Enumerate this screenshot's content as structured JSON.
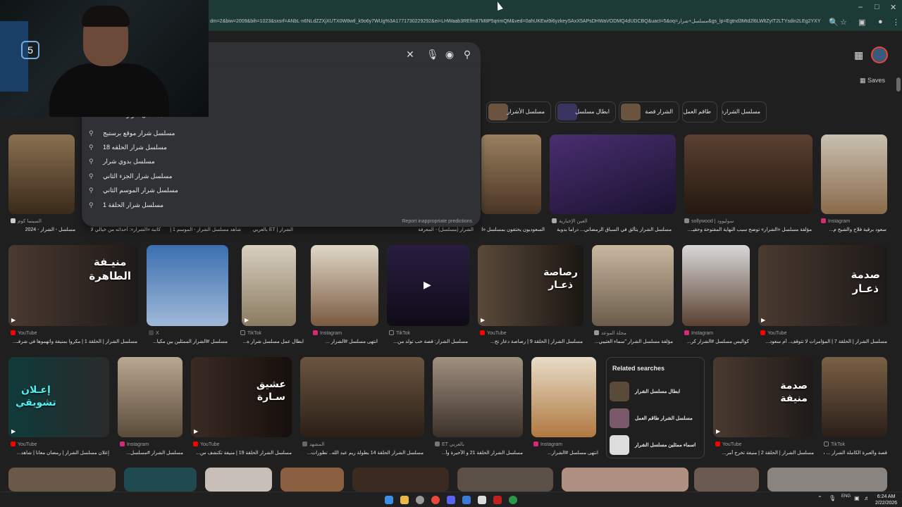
{
  "browser": {
    "url": "dm=2&biw=2009&bih=1023&sxsrf=ANbL-n6NLdZZXjXUTX0W8wtl_k9o6y7WUg%3A1771730229292&ei=LHWaab3REfm87M8P5qrimQM&ved=0ahUKEwi9i6yzkeySAxX5APsDHWaVODMQ4dUDCBQ&uact=5&oq=مسلسل+شرار&gs_lp=Egtnd3Mtd2l6LWltZyIT2LTYsdin2LEg2YXY"
  },
  "search": {
    "suggestions": [
      "مسلسل شرار موقع برستيج",
      "مسلسل شرار الحلقه 18",
      "مسلسل بدوي شرار",
      "مسلسل شرار الجزء الثاني",
      "مسلسل شرار الموسم الثاني",
      "مسلسل شرار الحلقة 1"
    ],
    "partial_suggestion": "مسلسل شرار الحلقة 1",
    "report_label": "Report inappropriate predictions"
  },
  "header": {
    "saves_label": "Saves"
  },
  "chips": [
    "مسلسل الأشرار",
    "ابطال مسلسل",
    "الشرار قصة",
    "طاقم العمل",
    "مسلسل الشرارة"
  ],
  "row1": [
    {
      "source": "Instagram",
      "caption": "سعود برقية فلاح والشيخ م..."
    },
    {
      "source": "sollywood | سوليوود",
      "caption": "مؤلفة مسلسل «الشرار» توضح سبب النهاية المفتوحة وحقيـ..."
    },
    {
      "source": "العين الإخبارية",
      "caption": "مسلسل الشرار يتألق في السباق الرمضاني... دراما بدوية"
    },
    {
      "source": "",
      "caption": "السعوديون يحتفون بمسلسل «الشرا..."
    },
    {
      "source": "",
      "caption": "الشرار (مسلسل) - المعرفة"
    },
    {
      "source": "",
      "caption": "الشرار | ET بالعربي"
    },
    {
      "source": "",
      "caption": "شاهد مسلسل الشرار - الموسم 1 |"
    },
    {
      "source": "",
      "caption": "كاتبة «الشرار»: أحداثه من خيالي لا..."
    },
    {
      "source": "السينما كوم",
      "caption": "مسلسل - الشرار - 2024"
    }
  ],
  "row2": [
    {
      "source": "YouTube",
      "caption": "مسلسل الشرار | الحلقة 1 | مكروا بمنيفة واتهموها في شرفـ...",
      "overlay": "منيـفة\nالطاهرة"
    },
    {
      "source": "X",
      "caption": "مسلسل #الشرار الممثلين بين مكيا...",
      "overlay": ""
    },
    {
      "source": "TikTok",
      "caption": "ابطال عمل مسلسل شرار ه...",
      "overlay": ""
    },
    {
      "source": "Instagram",
      "caption": "انتهى مسلسل #الشرار ...",
      "overlay": ""
    },
    {
      "source": "TikTok",
      "caption": "مسلسل الشرار: قصة حب تولد من...",
      "overlay": ""
    },
    {
      "source": "YouTube",
      "caption": "مسلسل الشرار | الحلقة 9 | رصاصة دعار تخ...",
      "overlay": "رصاصة\nذعـار"
    },
    {
      "source": "مجلة الموعد",
      "caption": "مؤلفة مسلسل الشرار \"سماء العتيبي...",
      "overlay": ""
    },
    {
      "source": "Instagram",
      "caption": "كواليس مسلسل #الشرار كر...",
      "overlay": ""
    },
    {
      "source": "YouTube",
      "caption": "مسلسل الشرار | الحلقة 7 | المؤامرات لا تتوقف.. أم سعود...",
      "overlay": "صدمة\nذعـار"
    }
  ],
  "row3": [
    {
      "source": "YouTube",
      "caption": "إعلان مسلسل الشرار | رمضان معانا | شاهد...",
      "overlay": "إعـلان\nتشويقي"
    },
    {
      "source": "Instagram",
      "caption": "مسلسل الشرار #مسلسل...",
      "overlay": ""
    },
    {
      "source": "YouTube",
      "caption": "مسلسل الشرار الحلقة 19 | منيفة تكتشف س...",
      "overlay": "عشيق\nسـارة"
    },
    {
      "source": "المشهد",
      "caption": "مسلسل الشرار الحلقة 14 بطولة ريم عبد الله.. تطورات...",
      "overlay": ""
    },
    {
      "source": "ET بالعربي",
      "caption": "مسلسل الشرار الحلقة 21 و الأخيرة وأ...",
      "overlay": ""
    },
    {
      "source": "Instagram",
      "caption": "انتهى مسلسل #الشرار...",
      "overlay": ""
    },
    {
      "source": "YouTube",
      "caption": "مسلسل الشرار | الحلقة 2 | منيفة تخرج أمر...",
      "overlay": "صدمة\nمنيفة"
    },
    {
      "source": "TikTok",
      "caption": "قصة والعبرة الكاملة الشرار ... مسلسـ...",
      "overlay": ""
    }
  ],
  "related": {
    "title": "Related searches",
    "items": [
      "ابطال مسلسل الشرار",
      "مسلسل الشرار طاقم العمل",
      "اسماء ممثلين مسلسل الشرار"
    ]
  },
  "taskbar": {
    "time": "6:24 AM",
    "date": "2/22/2026",
    "lang": "ENG"
  }
}
